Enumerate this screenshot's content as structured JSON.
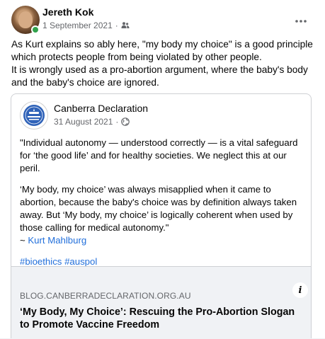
{
  "post": {
    "author": "Jereth Kok",
    "date": "1 September 2021",
    "separator": "·",
    "audience_icon": "friends-icon",
    "more_icon": "ellipsis-icon",
    "text_line1": "As Kurt explains so ably here, \"my body my choice\" is a good principle which protects people from being violated by other people.",
    "text_line2": "It is wrongly used as a pro-abortion argument, where the baby's body and the baby's choice are ignored."
  },
  "shared": {
    "page_name": "Canberra Declaration",
    "logo_text": "CANBERRA DECLARATION",
    "date": "31 August 2021",
    "separator": "·",
    "audience_icon": "globe-icon",
    "para1": "\"Individual autonomy — understood correctly — is a vital safeguard for ‘the good life’ and for healthy societies. We neglect this at our peril.",
    "para2": "‘My body, my choice’ was always misapplied when it came to abortion, because the baby's choice was by definition always taken away. But ‘My body, my choice’ is logically coherent when used by those calling for medical autonomy.\"",
    "attribution_prefix": "~ ",
    "attribution_name": "Kurt Mahlburg",
    "hashtag1": "#bioethics",
    "hashtag2": "#auspol"
  },
  "link_preview": {
    "domain": "BLOG.CANBERRADECLARATION.ORG.AU",
    "title": "‘My Body, My Choice’: Rescuing the Pro-Abortion Slogan to Promote Vaccine Freedom",
    "info_icon": "info-icon",
    "info_label": "i"
  },
  "colors": {
    "link": "#216fdb",
    "online": "#31a24c",
    "meta": "#65676b",
    "logo_blue": "#2f62b8"
  }
}
